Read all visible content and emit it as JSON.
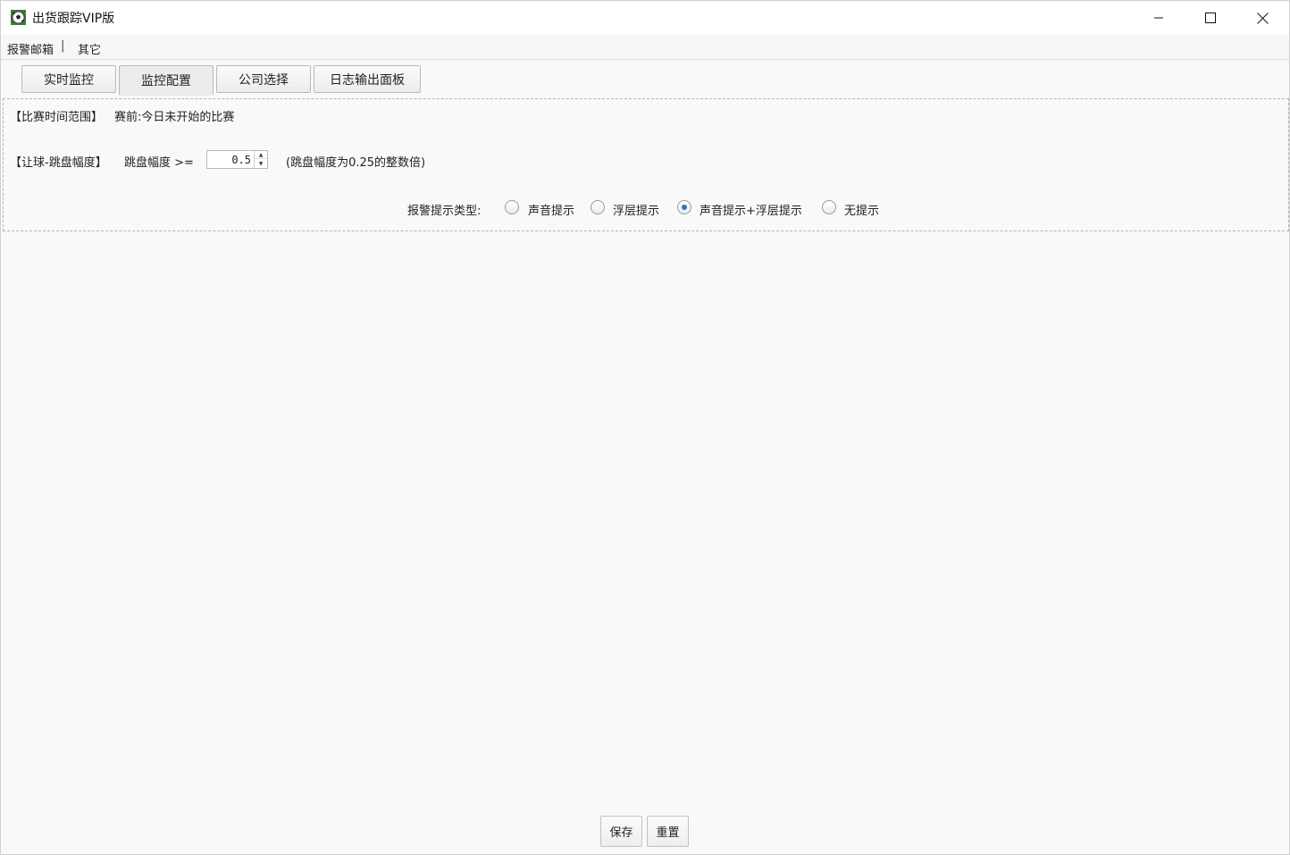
{
  "window": {
    "title": "出货跟踪VIP版",
    "icon": "soccer-ball-icon",
    "controls": [
      "minimize-icon",
      "maximize-icon",
      "close-icon"
    ]
  },
  "menu": {
    "items": [
      "报警邮箱",
      "其它"
    ],
    "separator": "|"
  },
  "tabs": [
    {
      "label": "实时监控",
      "active": false
    },
    {
      "label": "监控配置",
      "active": true
    },
    {
      "label": "公司选择",
      "active": false
    },
    {
      "label": "日志输出面板",
      "active": false
    }
  ],
  "config": {
    "time_range": {
      "label": "【比赛时间范围】",
      "value": "赛前:今日未开始的比赛"
    },
    "handicap": {
      "label": "【让球-跳盘幅度】",
      "field_label": "跳盘幅度 >=",
      "value": "0.5",
      "hint": "(跳盘幅度为0.25的整数倍)"
    },
    "alert_type": {
      "label": "报警提示类型:",
      "options": [
        {
          "label": "声音提示",
          "checked": false
        },
        {
          "label": "浮层提示",
          "checked": false
        },
        {
          "label": "声音提示+浮层提示",
          "checked": true
        },
        {
          "label": "无提示",
          "checked": false
        }
      ]
    }
  },
  "buttons": {
    "save": "保存",
    "reset": "重置"
  },
  "colors": {
    "radio_selected": "#3a6fb5",
    "panel_border": "#b5b5b5"
  }
}
